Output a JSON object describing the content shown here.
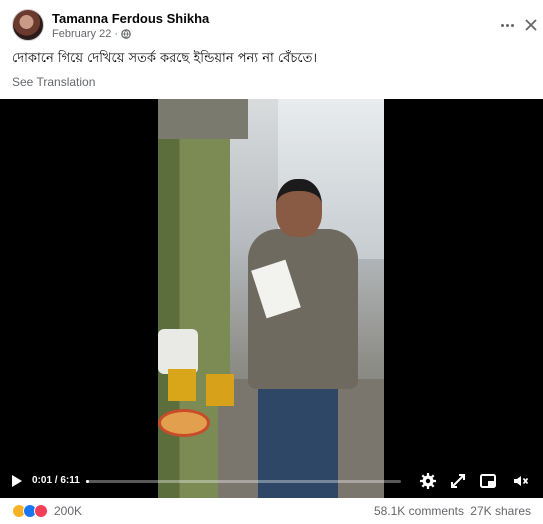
{
  "post": {
    "author": "Tamanna Ferdous Shikha",
    "date": "February 22",
    "dot": "·",
    "privacy_icon": "globe-icon",
    "caption": "দোকানে গিয়ে দেখিয়ে সতর্ক করছে ইন্ডিয়ান পন্য না বেঁচতে।",
    "see_translation": "See Translation"
  },
  "video": {
    "time": "0:01 / 6:11",
    "progress": 0.003,
    "controls": [
      "play-icon",
      "settings-icon",
      "fullscreen-toggle-icon",
      "pip-icon",
      "fullscreen-icon",
      "volume-icon"
    ]
  },
  "stats": {
    "reactions": [
      "haha",
      "like",
      "love"
    ],
    "reaction_colors": {
      "haha": "#f7b125",
      "like": "#1877f2",
      "love": "#f33e58"
    },
    "reaction_count": "200K",
    "comments": "58.1K comments",
    "shares": "27K shares"
  }
}
